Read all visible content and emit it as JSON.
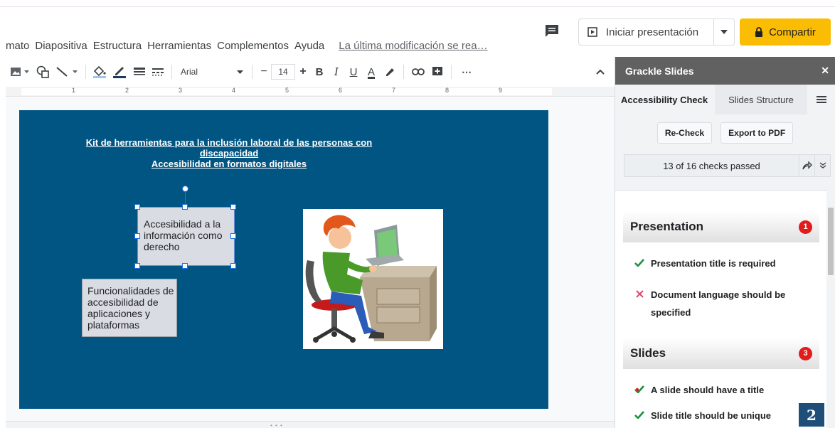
{
  "menu": {
    "items": [
      "mato",
      "Diapositiva",
      "Estructura",
      "Herramientas",
      "Complementos",
      "Ayuda"
    ],
    "last_edit": "La última modificación se rea…"
  },
  "header": {
    "present_label": "Iniciar presentación",
    "share_label": "Compartir",
    "comment_icon": "comment-icon"
  },
  "toolbar": {
    "font": "Arial",
    "font_size": "14",
    "minus": "−",
    "plus": "+",
    "bold": "B",
    "italic": "I",
    "underline": "U",
    "text_color": "A",
    "more": "⋯",
    "collapse": "^"
  },
  "ruler": {
    "numbers": [
      "1",
      "2",
      "3",
      "4",
      "5",
      "6",
      "7",
      "8",
      "9"
    ]
  },
  "slide": {
    "background": "#005583",
    "title_line1": "Kit de herramientas para la inclusión laboral de las personas con discapacidad",
    "title_line2": "Accesibilidad en formatos digitales",
    "box1_text": "Accesibilidad a la información como derecho",
    "box2_text": "Funcionalidades de accesibilidad de aplicaciones y plataformas"
  },
  "panel": {
    "title": "Grackle Slides",
    "close": "✕",
    "tabs": [
      "Accessibility Check",
      "Slides Structure"
    ],
    "recheck_label": "Re-Check",
    "export_label": "Export to PDF",
    "checks_summary": "13 of 16 checks passed",
    "sections": [
      {
        "name": "Presentation",
        "count": "1",
        "checks": [
          {
            "text": "Presentation title is required",
            "status": "pass"
          },
          {
            "text": "Document language should be specified",
            "status": "fail"
          }
        ]
      },
      {
        "name": "Slides",
        "count": "3",
        "checks": [
          {
            "text": "A slide should have a title",
            "status": "partial"
          },
          {
            "text": "Slide title should be unique",
            "status": "pass"
          }
        ]
      }
    ]
  },
  "page_badge": "2",
  "colors": {
    "accent_yellow": "#fbbc04",
    "panel_header": "#616161",
    "pass_green": "#1e8e3e",
    "fail_red": "#e21b1b"
  }
}
